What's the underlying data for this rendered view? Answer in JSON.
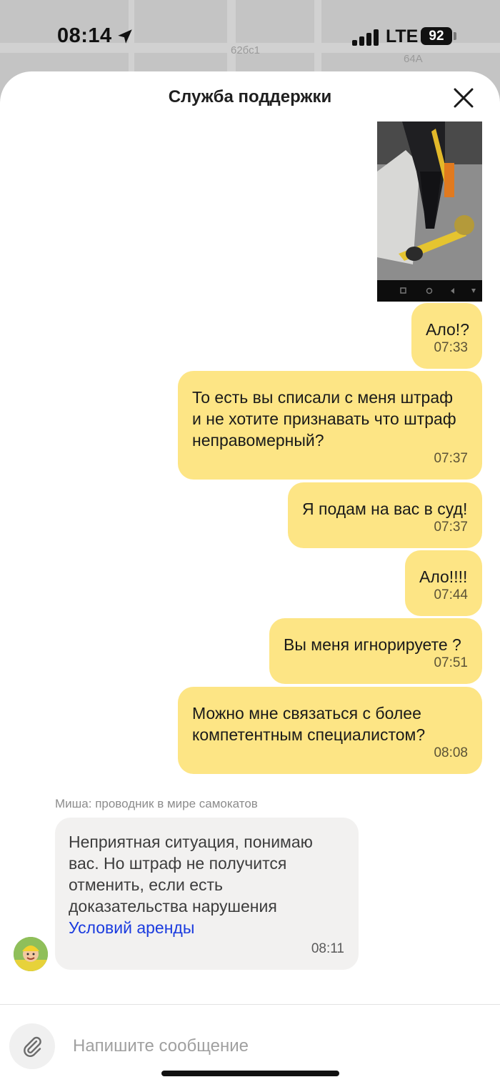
{
  "status_bar": {
    "time": "08:14",
    "network": "LTE",
    "battery": "92"
  },
  "map": {
    "labels": [
      "62бс1",
      "64А"
    ]
  },
  "header": {
    "title": "Служба поддержки"
  },
  "messages_out": [
    {
      "text": "Ало!?",
      "time": "07:33"
    },
    {
      "text": "То есть вы списали с меня штраф\nи не хотите признавать что штраф\nнеправомерный?",
      "time": "07:37"
    },
    {
      "text": "Я подам на вас в суд!",
      "time": "07:37"
    },
    {
      "text": "Ало!!!!",
      "time": "07:44"
    },
    {
      "text": "Вы меня игнорируете ?",
      "time": "07:51"
    },
    {
      "text": "Можно мне связаться с более\nкомпетентным специалистом?",
      "time": "08:08"
    }
  ],
  "incoming": {
    "sender": "Миша: проводник в мире самокатов",
    "text": "Неприятная ситуация, понимаю вас. Но штраф не получится отменить, если есть доказательства нарушения",
    "link": "Условий аренды",
    "time": "08:11"
  },
  "composer": {
    "placeholder": "Напишите сообщение"
  },
  "colors": {
    "outgoing_bubble": "#fde585",
    "incoming_bubble": "#f2f1f0",
    "link": "#1a3bdf"
  }
}
